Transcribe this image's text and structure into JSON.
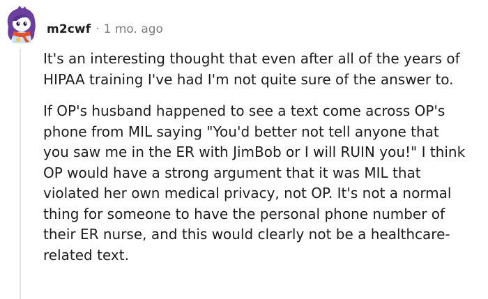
{
  "comment": {
    "username": "m2cwf",
    "separator": "·",
    "time": "1 mo. ago",
    "paragraphs": [
      {
        "lines": [
          "It's an interesting thought that even after all of the years of",
          "HIPAA training I've had I'm not quite sure of the answer to."
        ]
      },
      {
        "lines": [
          "If OP's husband happened to see a text come across OP's",
          "phone from MIL saying \"You'd better not tell anyone that",
          "you saw me in the ER with JimBob or I will RUIN you!\" I think",
          "OP would have a strong argument that it was MIL that",
          "violated her own medical privacy, not OP. It's not a normal",
          "thing for someone to have the personal phone number of",
          "their ER nurse, and this would clearly not be a healthcare-",
          "related text."
        ]
      }
    ]
  },
  "avatar": {
    "icon": "snoo-avatar-icon",
    "colors": {
      "hair": "#6b3fa0",
      "face": "#ffffff",
      "scarf": "#e8502d",
      "body": "#c7e3f7"
    }
  },
  "colors": {
    "text": "#1c1c1c",
    "meta": "#7c7c7c",
    "thread_line": "#e6e6e6"
  }
}
